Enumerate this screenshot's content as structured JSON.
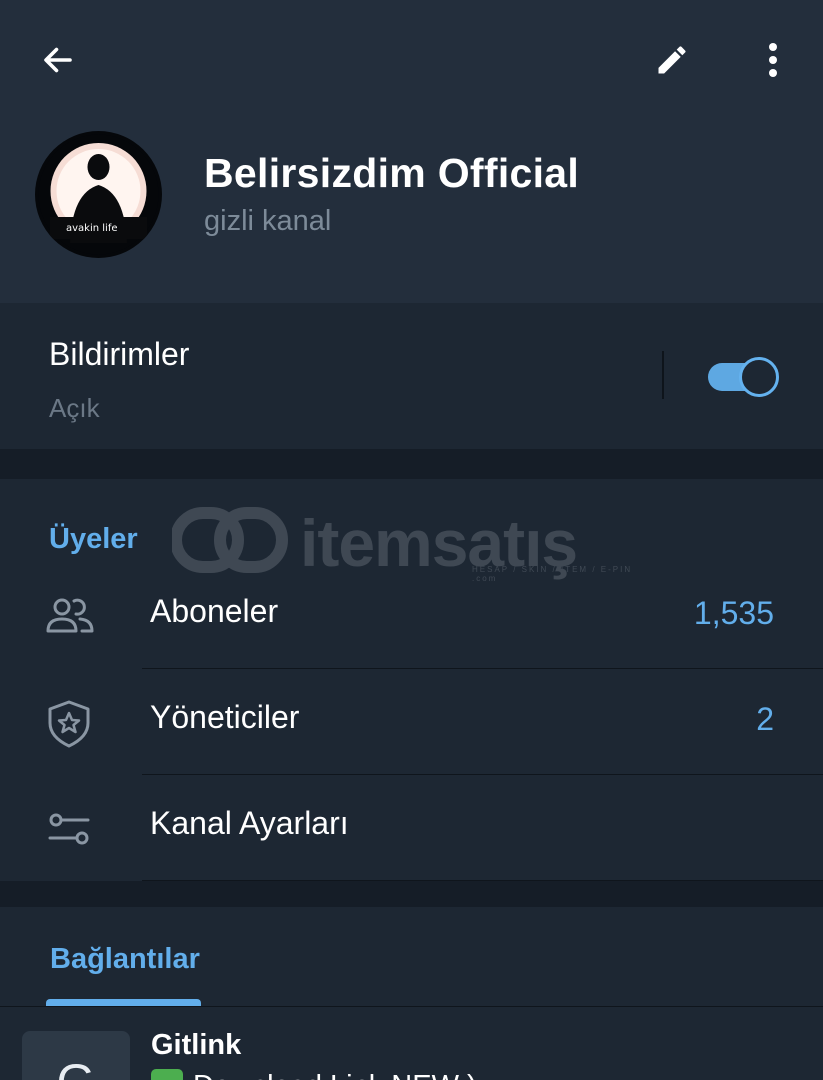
{
  "topbar": {
    "back_icon": "arrow-left-icon",
    "edit_icon": "pencil-icon",
    "more_icon": "more-vertical-icon"
  },
  "channel": {
    "title": "Belirsizdim Official",
    "subtitle": "gizli kanal",
    "avatar_text": "avakin life"
  },
  "notifications": {
    "title": "Bildirimler",
    "status": "Açık",
    "enabled": true
  },
  "watermark": {
    "text": "itemsatış",
    "sub": "HESAP / SKIN / ITEM / E-PIN .com"
  },
  "members": {
    "section_title": "Üyeler",
    "rows": [
      {
        "label": "Aboneler",
        "value": "1,535",
        "icon": "people-icon"
      },
      {
        "label": "Yöneticiler",
        "value": "2",
        "icon": "shield-star-icon"
      },
      {
        "label": "Kanal Ayarları",
        "value": "",
        "icon": "sliders-icon"
      }
    ]
  },
  "links": {
    "section_title": "Bağlantılar",
    "items": [
      {
        "thumb_letter": "G",
        "title": "Gitlink",
        "subtitle": "Download Link NEW ) "
      }
    ]
  },
  "colors": {
    "accent": "#62aeeb",
    "header_bg": "#232e3c",
    "body_bg": "#1d2733"
  }
}
